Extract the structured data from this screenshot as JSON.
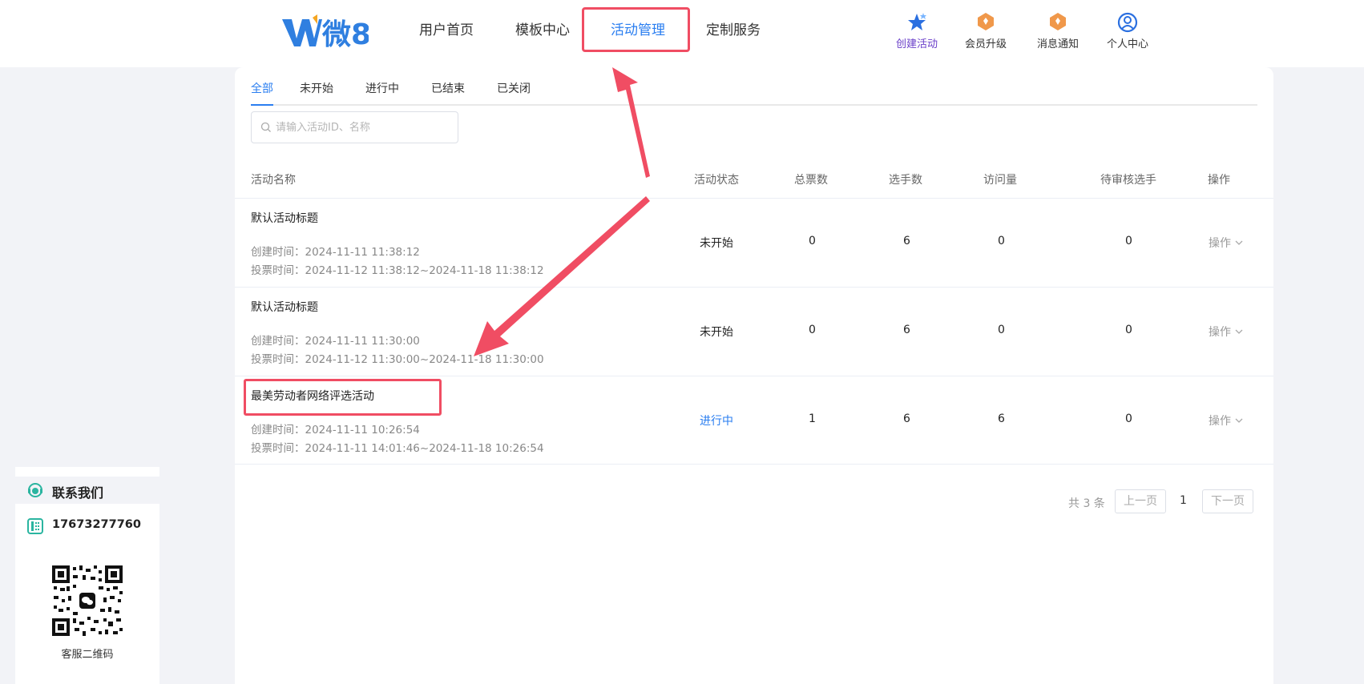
{
  "header": {
    "logo_text": "微8",
    "nav": [
      "用户首页",
      "模板中心",
      "活动管理",
      "定制服务"
    ],
    "actions": {
      "create": "创建活动",
      "upgrade": "会员升级",
      "notify": "消息通知",
      "profile": "个人中心"
    }
  },
  "tabs": [
    "全部",
    "未开始",
    "进行中",
    "已结束",
    "已关闭"
  ],
  "search": {
    "placeholder": "请输入活动ID、名称",
    "value": ""
  },
  "table": {
    "headers": {
      "name": "活动名称",
      "status": "活动状态",
      "votes": "总票数",
      "players": "选手数",
      "visits": "访问量",
      "pending": "待审核选手",
      "op": "操作"
    },
    "rows": [
      {
        "name": "默认活动标题",
        "created": "创建时间：2024-11-11 11:38:12",
        "vote_time": "投票时间：2024-11-12 11:38:12~2024-11-18 11:38:12",
        "status": "未开始",
        "votes": "0",
        "players": "6",
        "visits": "0",
        "pending": "0",
        "op": "操作"
      },
      {
        "name": "默认活动标题",
        "created": "创建时间：2024-11-11 11:30:00",
        "vote_time": "投票时间：2024-11-12 11:30:00~2024-11-18 11:30:00",
        "status": "未开始",
        "votes": "0",
        "players": "6",
        "visits": "0",
        "pending": "0",
        "op": "操作"
      },
      {
        "name": "最美劳动者网络评选活动",
        "created": "创建时间：2024-11-11 10:26:54",
        "vote_time": "投票时间：2024-11-11 14:01:46~2024-11-18 10:26:54",
        "status": "进行中",
        "votes": "1",
        "players": "6",
        "visits": "6",
        "pending": "0",
        "op": "操作"
      }
    ]
  },
  "pagination": {
    "total": "共 3 条",
    "prev": "上一页",
    "page": "1",
    "next": "下一页"
  },
  "contact": {
    "title": "联系我们",
    "phone": "17673277760",
    "qr_label": "客服二维码"
  },
  "colors": {
    "accent": "#2a7ef0",
    "highlight": "#f04d63"
  }
}
